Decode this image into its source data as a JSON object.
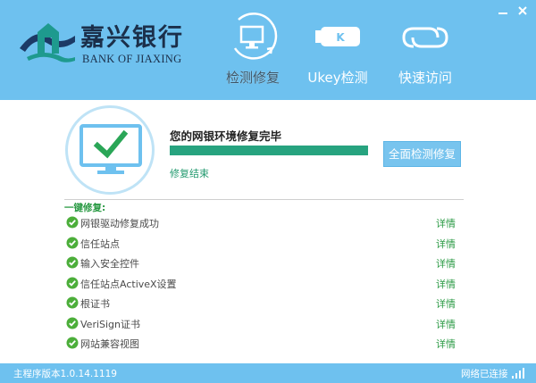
{
  "window": {
    "minimize_icon": "minimize-icon",
    "close_icon": "close-icon"
  },
  "brand": {
    "name_cn": "嘉兴银行",
    "name_en": "BANK OF JIAXING",
    "logo_icon": "bank-logo-icon"
  },
  "nav": {
    "items": [
      {
        "label": "检测修复",
        "icon": "monitor-refresh-icon",
        "active": true
      },
      {
        "label": "Ukey检测",
        "icon": "ukey-icon",
        "active": false
      },
      {
        "label": "快速访问",
        "icon": "link-icon",
        "active": false
      }
    ]
  },
  "status": {
    "title": "您的网银环境修复完毕",
    "subtitle": "修复结束",
    "progress": 1.0,
    "action_button": "全面检测修复",
    "icon": "monitor-check-icon"
  },
  "repair_list": {
    "section_title": "一键修复:",
    "detail_label": "详情",
    "items": [
      {
        "label": "网银驱动修复成功",
        "status": "ok"
      },
      {
        "label": "信任站点",
        "status": "ok"
      },
      {
        "label": "输入安全控件",
        "status": "ok"
      },
      {
        "label": "信任站点ActiveX设置",
        "status": "ok"
      },
      {
        "label": "根证书",
        "status": "ok"
      },
      {
        "label": "VeriSign证书",
        "status": "ok"
      },
      {
        "label": "网站兼容视图",
        "status": "ok"
      }
    ]
  },
  "footer": {
    "version": "主程序版本1.0.14.1119",
    "network_status": "网络已连接",
    "signal_icon": "signal-icon"
  },
  "colors": {
    "header_bg": "#6ec1ef",
    "accent_green": "#27a37f",
    "ok_green": "#4cae3a",
    "button_bg": "#78c4ee"
  }
}
